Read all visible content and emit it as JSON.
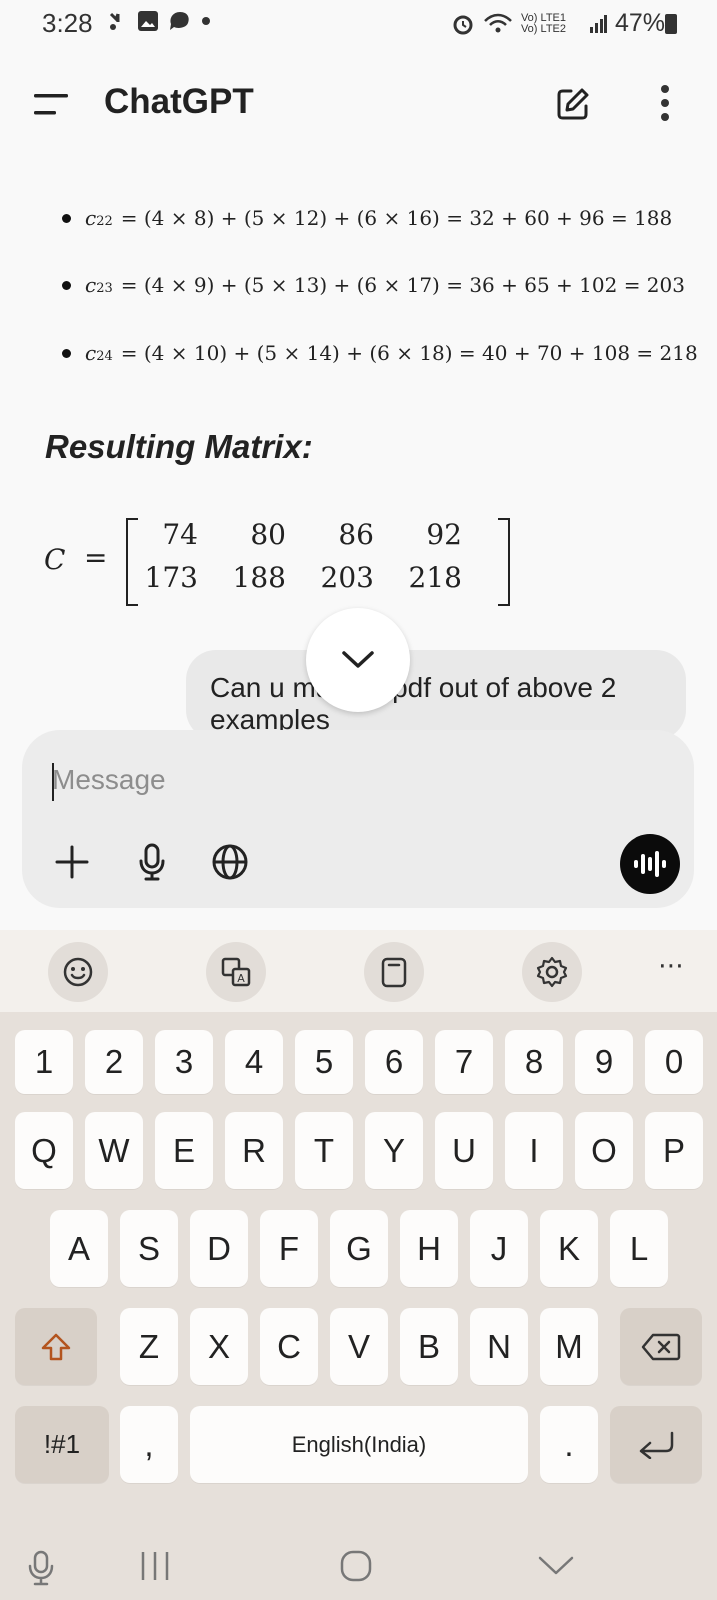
{
  "status_bar": {
    "time": "3:28",
    "network": "Vo) LTE1 Vo) LTE2",
    "battery": "47%"
  },
  "header": {
    "title": "ChatGPT"
  },
  "chat": {
    "bullets": [
      {
        "sub": "22",
        "formula": "= (4 × 8) + (5 × 12) + (6 × 16) = 32 + 60 + 96 = 188"
      },
      {
        "sub": "23",
        "formula": "= (4 × 9) + (5 × 13) + (6 × 17) = 36 + 65 + 102 = 203"
      },
      {
        "sub": "24",
        "formula": "= (4 × 10) + (5 × 14) + (6 × 18) = 40 + 70 + 108 = 218"
      }
    ],
    "heading": "Resulting Matrix:",
    "matrix": {
      "name": "C",
      "equals": "=",
      "rows": [
        [
          "74",
          "80",
          "86",
          "92"
        ],
        [
          "173",
          "188",
          "203",
          "218"
        ]
      ]
    },
    "user_message": "Can u make a pdf out of above 2 examples"
  },
  "composer": {
    "placeholder": "Message"
  },
  "keyboard": {
    "row_numbers": [
      "1",
      "2",
      "3",
      "4",
      "5",
      "6",
      "7",
      "8",
      "9",
      "0"
    ],
    "row_q": [
      "Q",
      "W",
      "E",
      "R",
      "T",
      "Y",
      "U",
      "I",
      "O",
      "P"
    ],
    "row_a": [
      "A",
      "S",
      "D",
      "F",
      "G",
      "H",
      "J",
      "K",
      "L"
    ],
    "row_z": [
      "Z",
      "X",
      "C",
      "V",
      "B",
      "N",
      "M"
    ],
    "symbols_label": "!#1",
    "comma": ",",
    "space_label": "English(India)",
    "period": ".",
    "more": "⋯"
  }
}
